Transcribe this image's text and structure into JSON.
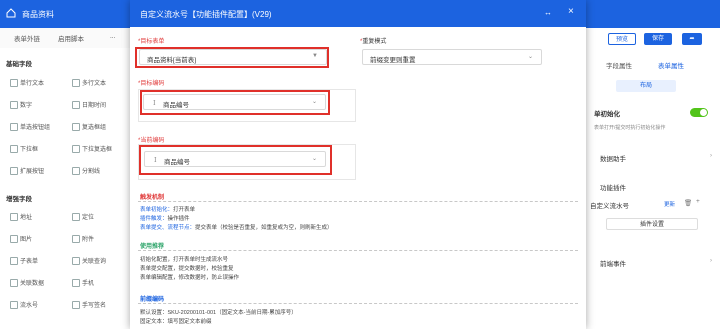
{
  "background": {
    "app_title": "商品资料",
    "toolbar": [
      "表单外链",
      "启用脚本",
      "..."
    ],
    "sections": [
      "基础字段",
      "增强字段"
    ],
    "basic_fields": [
      [
        "单行文本",
        "多行文本"
      ],
      [
        "数字",
        "日期时间"
      ],
      [
        "单选按钮组",
        "复选框组"
      ],
      [
        "下拉框",
        "下拉复选框"
      ],
      [
        "扩展按钮",
        "分割线"
      ]
    ],
    "enhanced_fields": [
      [
        "地址",
        "定位"
      ],
      [
        "图片",
        "附件"
      ],
      [
        "子表单",
        "关联查询"
      ],
      [
        "关联数据",
        "手机"
      ],
      [
        "流水号",
        "手写签名"
      ]
    ],
    "right_panel": {
      "btn_preview": "预览",
      "btn_save": "保存",
      "tabs": [
        "字段属性",
        "表单属性"
      ],
      "layout_label": "布局",
      "init_label": "单初始化",
      "init_desc": "表单打开/提交时执行初始化操作",
      "data_helper": "数据助手",
      "plugin_component": "功能插件",
      "plugin_item": "自定义流水号",
      "plugin_update": "更新",
      "plugin_settings": "插件设置",
      "frontend_event": "前端事件"
    }
  },
  "modal": {
    "title": "自定义流水号【功能插件配置】(V29)",
    "expand_icon": "↔",
    "close_icon": "×",
    "target_form_label": "目标表单",
    "target_form_value": "商品资料[当前表]",
    "duplicate_mode_label": "重复模式",
    "duplicate_mode_value": "前缀变更则重置",
    "target_code_label": "目标编码",
    "target_code_value": "商品编号",
    "current_code_label": "当前编码",
    "current_code_value": "商品编号",
    "trigger_title": "触发机制",
    "trigger_lines": [
      {
        "key": "表单初始化：",
        "text": "打开表单"
      },
      {
        "key": "插件触发：",
        "text": "操作插件"
      },
      {
        "key": "表单提交、流程节点：",
        "text": "提交表单（校验是否重复，如重复或为空，则刷新生成）"
      }
    ],
    "usage_title": "使用推荐",
    "usage_lines": [
      "初始化配置，打开表单时生成流水号",
      "表单提交配置，提交数据时，校验重复",
      "表单编辑配置，修改数据时，防止误操作"
    ],
    "rule_title": "前缀编码",
    "rule_lines": [
      "默认设置：SKU-20200101-001（固定文本-当前日期-累加序号）",
      "固定文本：填写固定文本前缀"
    ]
  },
  "colors": {
    "primary": "#1c63e0",
    "highlight_box": "#e0302a",
    "required": "#e03a3a",
    "toggle_on": "#52c41a"
  }
}
